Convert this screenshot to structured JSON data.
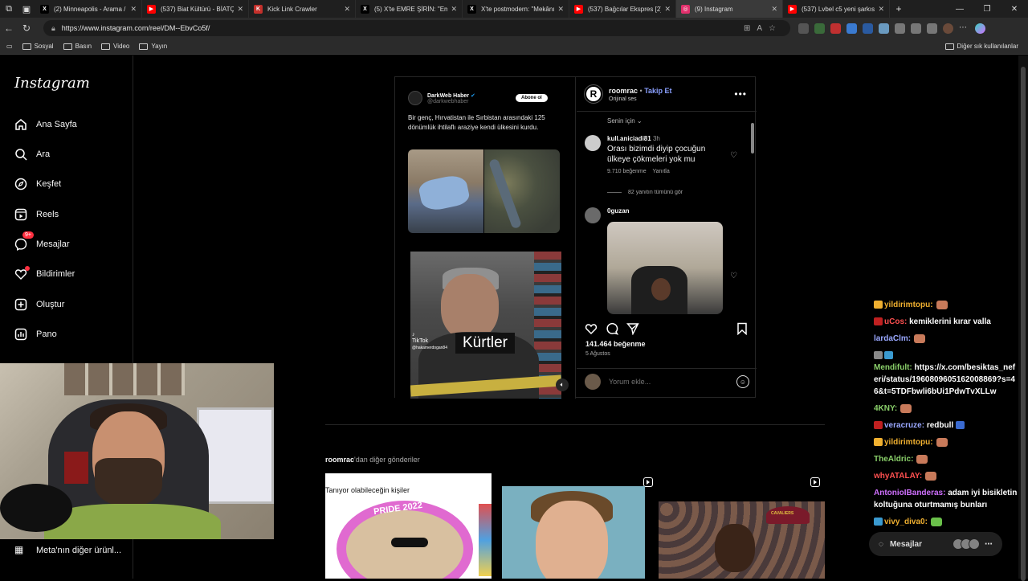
{
  "browser": {
    "tabs": [
      {
        "title": "(2) Minneapolis - Arama /",
        "icon": "x-icon",
        "color": "#000000"
      },
      {
        "title": "(537) Biat Kültürü - BİATÇIL",
        "icon": "youtube-icon",
        "color": "#ff0000"
      },
      {
        "title": "Kick Link Crawler",
        "icon": "kick-icon",
        "color": "#c4302b"
      },
      {
        "title": "(5) X'te EMRE ŞİRİN: \"Emlak",
        "icon": "x-icon",
        "color": "#000000"
      },
      {
        "title": "X'te postmodern: \"Mekânın",
        "icon": "x-icon",
        "color": "#000000"
      },
      {
        "title": "(537) Bağcılar Ekspres [2] (",
        "icon": "youtube-icon",
        "color": "#ff0000"
      },
      {
        "title": "(9) Instagram",
        "icon": "instagram-icon",
        "color": "#e1306c",
        "active": true
      },
      {
        "title": "(537) Lvbel c5 yeni şarkısını",
        "icon": "youtube-icon",
        "color": "#ff0000"
      }
    ],
    "url": "https://www.instagram.com/reel/DM--EbvCo5f/",
    "bookmarks": [
      "Sosyal",
      "Basın",
      "Video",
      "Yayın"
    ],
    "other_bookmarks": "Diğer sık kullanılanlar"
  },
  "sidebar": {
    "logo": "Instagram",
    "items": [
      {
        "label": "Ana Sayfa",
        "icon": "home-icon"
      },
      {
        "label": "Ara",
        "icon": "search-icon"
      },
      {
        "label": "Keşfet",
        "icon": "compass-icon"
      },
      {
        "label": "Reels",
        "icon": "reels-icon"
      },
      {
        "label": "Mesajlar",
        "icon": "messenger-icon",
        "badge": "9+"
      },
      {
        "label": "Bildirimler",
        "icon": "heart-icon"
      },
      {
        "label": "Oluştur",
        "icon": "plus-square-icon"
      },
      {
        "label": "Pano",
        "icon": "dashboard-icon"
      }
    ],
    "meta_more": "Meta'nın diğer ürünl..."
  },
  "post": {
    "tweet": {
      "name": "DarkWeb Haber",
      "handle": "@darkwebhaber",
      "follow": "Abone ol",
      "text": "Bir genç, Hırvatistan ile Sırbistan arasındaki 125 dönümlük ihtilaflı araziye kendi ülkesini kurdu."
    },
    "video_caption": "Kürtler",
    "tiktok_label": "TikTok",
    "tiktok_handle": "@hakamerdogan84",
    "author": "roomrac",
    "follow": "Takip Et",
    "separator": "•",
    "audio": "Orijinal ses",
    "sort": "Senin için",
    "comments": [
      {
        "user": "kull.aniciadi81",
        "time": "3h",
        "text": "Orası bizimdi diyip çocuğun ülkeye çökmeleri yok mu",
        "likes": "9.710 beğenme",
        "reply": "Yanıtla",
        "view_replies": "82 yanıtın tümünü gör"
      },
      {
        "user": "0guzan"
      }
    ],
    "likes": "141.464 beğenme",
    "date": "5 Ağustos",
    "comment_placeholder": "Yorum ekle..."
  },
  "more_posts": {
    "user": "roomrac",
    "suffix": "'dan diğer gönderiler"
  },
  "thumbnails": [
    {
      "overlay_title": "Tanıyor olabileceğin kişiler",
      "badge": "PRIDE 2022"
    },
    {
      "overlay_title": ""
    },
    {
      "overlay_title": "CAVALIERS"
    }
  ],
  "chat": [
    {
      "user": "",
      "text": "....",
      "user_color": "#ffffff"
    },
    {
      "user": "yildirimtopu:",
      "text": "",
      "user_color": "#f0b030"
    },
    {
      "user": "uCos:",
      "text": "kemiklerini kırar valla",
      "user_color": "#ff5050"
    },
    {
      "user": "lardaClm:",
      "text": "",
      "user_color": "#9aa8ff"
    },
    {
      "user": "Mendifult:",
      "text": "https://x.com/besiktas_neferi/status/19608096051620088​69?s=46&t=5TDFbwli6bUi1PdwTvXLLw",
      "user_color": "#8ad06a"
    },
    {
      "user": "4KNY:",
      "text": "",
      "user_color": "#8ad06a"
    },
    {
      "user": "veracruze:",
      "text": "redbull",
      "user_color": "#9aa8ff"
    },
    {
      "user": "yildirimtopu:",
      "text": "",
      "user_color": "#f0b030"
    },
    {
      "user": "TheAldric:",
      "text": "",
      "user_color": "#8ad06a"
    },
    {
      "user": "whyATALAY:",
      "text": "",
      "user_color": "#ff5050"
    },
    {
      "user": "AntonioIBanderas:",
      "text": "adam iyi bisikletin koltuğuna oturtmamış bunları",
      "user_color": "#d070ff"
    },
    {
      "user": "vivy_diva0:",
      "text": "",
      "user_color": "#f0b030"
    }
  ],
  "dm_pill": "Mesajlar"
}
